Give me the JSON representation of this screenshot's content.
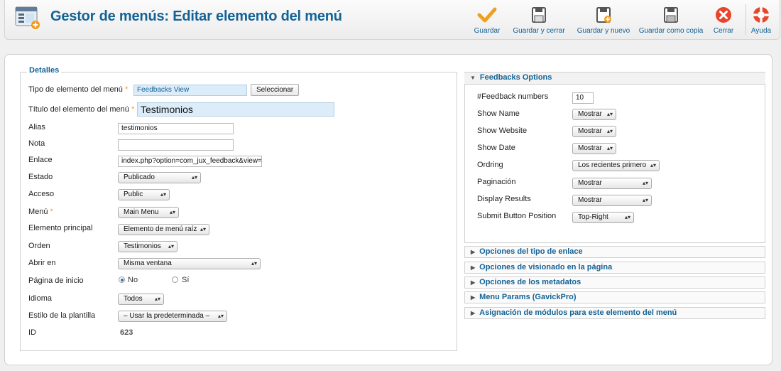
{
  "header": {
    "title": "Gestor de menús: Editar elemento del menú",
    "toolbar": {
      "save": "Guardar",
      "save_close": "Guardar y cerrar",
      "save_new": "Guardar y nuevo",
      "save_copy": "Guardar como copia",
      "close": "Cerrar",
      "help": "Ayuda"
    }
  },
  "details": {
    "legend": "Detalles",
    "menu_type_label": "Tipo de elemento del menú",
    "menu_type_value": "Feedbacks View",
    "select_button": "Seleccionar",
    "title_label": "Título del elemento del menú",
    "title_value": "Testimonios",
    "alias_label": "Alias",
    "alias_value": "testimonios",
    "note_label": "Nota",
    "note_value": "",
    "link_label": "Enlace",
    "link_value": "index.php?option=com_jux_feedback&view=",
    "status_label": "Estado",
    "status_value": "Publicado",
    "access_label": "Acceso",
    "access_value": "Public",
    "menu_label": "Menú",
    "menu_value": "Main Menu",
    "parent_label": "Elemento principal",
    "parent_value": "Elemento de menú raíz",
    "order_label": "Orden",
    "order_value": "Testimonios",
    "open_label": "Abrir en",
    "open_value": "Misma ventana",
    "home_label": "Página de inicio",
    "home_no": "No",
    "home_yes": "Sí",
    "language_label": "Idioma",
    "language_value": "Todos",
    "template_label": "Estilo de la plantilla",
    "template_value": "– Usar la predeterminada –",
    "id_label": "ID",
    "id_value": "623",
    "required_mark": "*"
  },
  "feedback_options": {
    "title": "Feedbacks Options",
    "numbers_label": "#Feedback numbers",
    "numbers_value": "10",
    "show_name_label": "Show Name",
    "show_name_value": "Mostrar",
    "show_website_label": "Show Website",
    "show_website_value": "Mostrar",
    "show_date_label": "Show Date",
    "show_date_value": "Mostrar",
    "ordering_label": "Ordring",
    "ordering_value": "Los recientes primero",
    "pagination_label": "Paginación",
    "pagination_value": "Mostrar",
    "display_results_label": "Display Results",
    "display_results_value": "Mostrar",
    "submit_pos_label": "Submit Button Position",
    "submit_pos_value": "Top-Right"
  },
  "collapsed_panels": [
    "Opciones del tipo de enlace",
    "Opciones de visionado en la página",
    "Opciones de los metadatos",
    "Menu Params (GavickPro)",
    "Asignación de módulos para este elemento del menú"
  ],
  "icons": {
    "app": "menu-manager-icon",
    "save": "checkmark-icon",
    "save_close": "floppy-icon",
    "save_new": "floppy-plus-icon",
    "save_copy": "floppy-copy-icon",
    "close": "close-circle-icon",
    "help": "lifebuoy-icon"
  },
  "colors": {
    "accent": "#146295",
    "required": "#e8a03a",
    "close": "#e8452c",
    "save": "#f0a020"
  }
}
